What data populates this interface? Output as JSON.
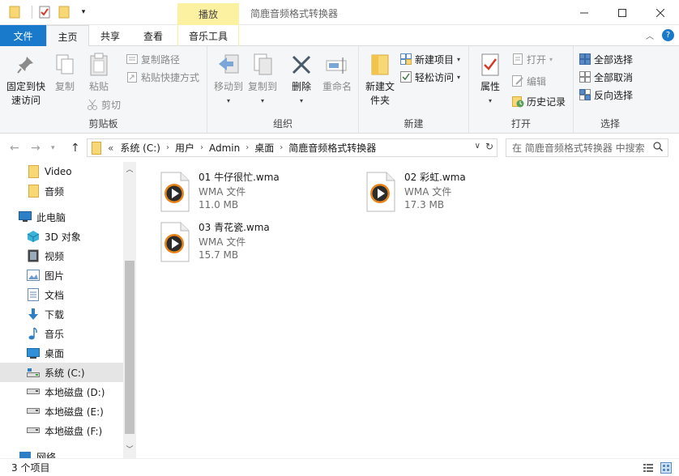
{
  "window": {
    "title": "简鹿音频格式转换器",
    "context_tab": "播放"
  },
  "tabs": {
    "file": "文件",
    "home": "主页",
    "share": "共享",
    "view": "查看",
    "music_tools": "音乐工具"
  },
  "ribbon": {
    "clipboard": {
      "label": "剪贴板",
      "pin": "固定到快速访问",
      "copy": "复制",
      "paste": "粘贴",
      "copy_path": "复制路径",
      "paste_shortcut": "粘贴快捷方式",
      "cut": "剪切"
    },
    "organize": {
      "label": "组织",
      "move_to": "移动到",
      "copy_to": "复制到",
      "delete": "删除",
      "rename": "重命名"
    },
    "new": {
      "label": "新建",
      "new_folder": "新建文件夹",
      "new_item": "新建项目",
      "easy_access": "轻松访问"
    },
    "open": {
      "label": "打开",
      "properties": "属性",
      "open": "打开",
      "edit": "编辑",
      "history": "历史记录"
    },
    "select": {
      "label": "选择",
      "select_all": "全部选择",
      "select_none": "全部取消",
      "invert": "反向选择"
    }
  },
  "address": {
    "overflow": "«",
    "crumbs": [
      "系统 (C:)",
      "用户",
      "Admin",
      "桌面",
      "简鹿音频格式转换器"
    ],
    "search_placeholder": "在 简鹿音频格式转换器 中搜索"
  },
  "navpane": {
    "items": [
      {
        "label": "Video",
        "icon": "folder-icon"
      },
      {
        "label": "音频",
        "icon": "folder-icon"
      },
      {
        "label": "此电脑",
        "icon": "computer-icon"
      },
      {
        "label": "3D 对象",
        "icon": "3d-objects-icon"
      },
      {
        "label": "视频",
        "icon": "video-icon"
      },
      {
        "label": "图片",
        "icon": "pictures-icon"
      },
      {
        "label": "文档",
        "icon": "documents-icon"
      },
      {
        "label": "下载",
        "icon": "download-icon"
      },
      {
        "label": "音乐",
        "icon": "music-icon"
      },
      {
        "label": "桌面",
        "icon": "desktop-icon"
      },
      {
        "label": "系统 (C:)",
        "icon": "system-drive-icon"
      },
      {
        "label": "本地磁盘 (D:)",
        "icon": "drive-icon"
      },
      {
        "label": "本地磁盘 (E:)",
        "icon": "drive-icon"
      },
      {
        "label": "本地磁盘 (F:)",
        "icon": "drive-icon"
      },
      {
        "label": "网络",
        "icon": "network-icon"
      }
    ]
  },
  "files": [
    {
      "name": "01 牛仔很忙.wma",
      "type": "WMA 文件",
      "size": "11.0 MB"
    },
    {
      "name": "02 彩虹.wma",
      "type": "WMA 文件",
      "size": "17.3 MB"
    },
    {
      "name": "03 青花瓷.wma",
      "type": "WMA 文件",
      "size": "15.7 MB"
    }
  ],
  "status": {
    "count": "3 个项目"
  },
  "colors": {
    "accent": "#1979ca",
    "context_tab": "#fcf1a0",
    "folder": "#f8d775",
    "selection": "#e5e5e5"
  }
}
